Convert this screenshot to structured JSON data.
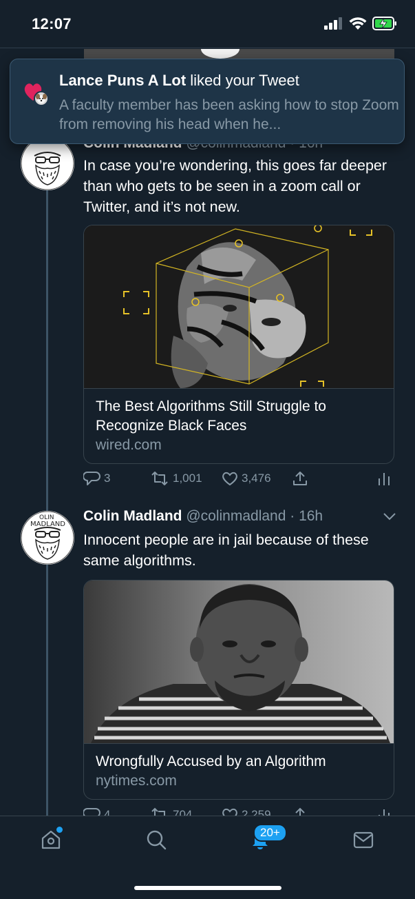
{
  "status_bar": {
    "time": "12:07"
  },
  "notification": {
    "user": "Lance Puns A Lot",
    "action": " liked your Tweet",
    "preview": "A faculty member has been asking how to stop Zoom from removing his head when he..."
  },
  "tweets": [
    {
      "name": "Colin Madland",
      "handle": "@colinmadland · 16h",
      "text": "In case you’re wondering, this goes far deeper than who gets to be seen in a zoom call or Twitter, and it’s not new.",
      "card": {
        "title": "The Best Algorithms Still Struggle to Recognize Black Faces",
        "domain": "wired.com"
      },
      "replies": "3",
      "retweets": "1,001",
      "likes": "3,476"
    },
    {
      "name": "Colin Madland",
      "handle": "@colinmadland · 16h",
      "text": "Innocent people are in jail because of these same algorithms.",
      "card": {
        "title": "Wrongfully Accused by an Algorithm",
        "domain": "nytimes.com"
      },
      "replies": "4",
      "retweets": "704",
      "likes": "2,259"
    }
  ],
  "nav": {
    "notifications_badge": "20+"
  },
  "colors": {
    "background": "#15202b",
    "accent": "#1da1f2",
    "secondary_text": "#8899a6",
    "like": "#e0245e"
  }
}
